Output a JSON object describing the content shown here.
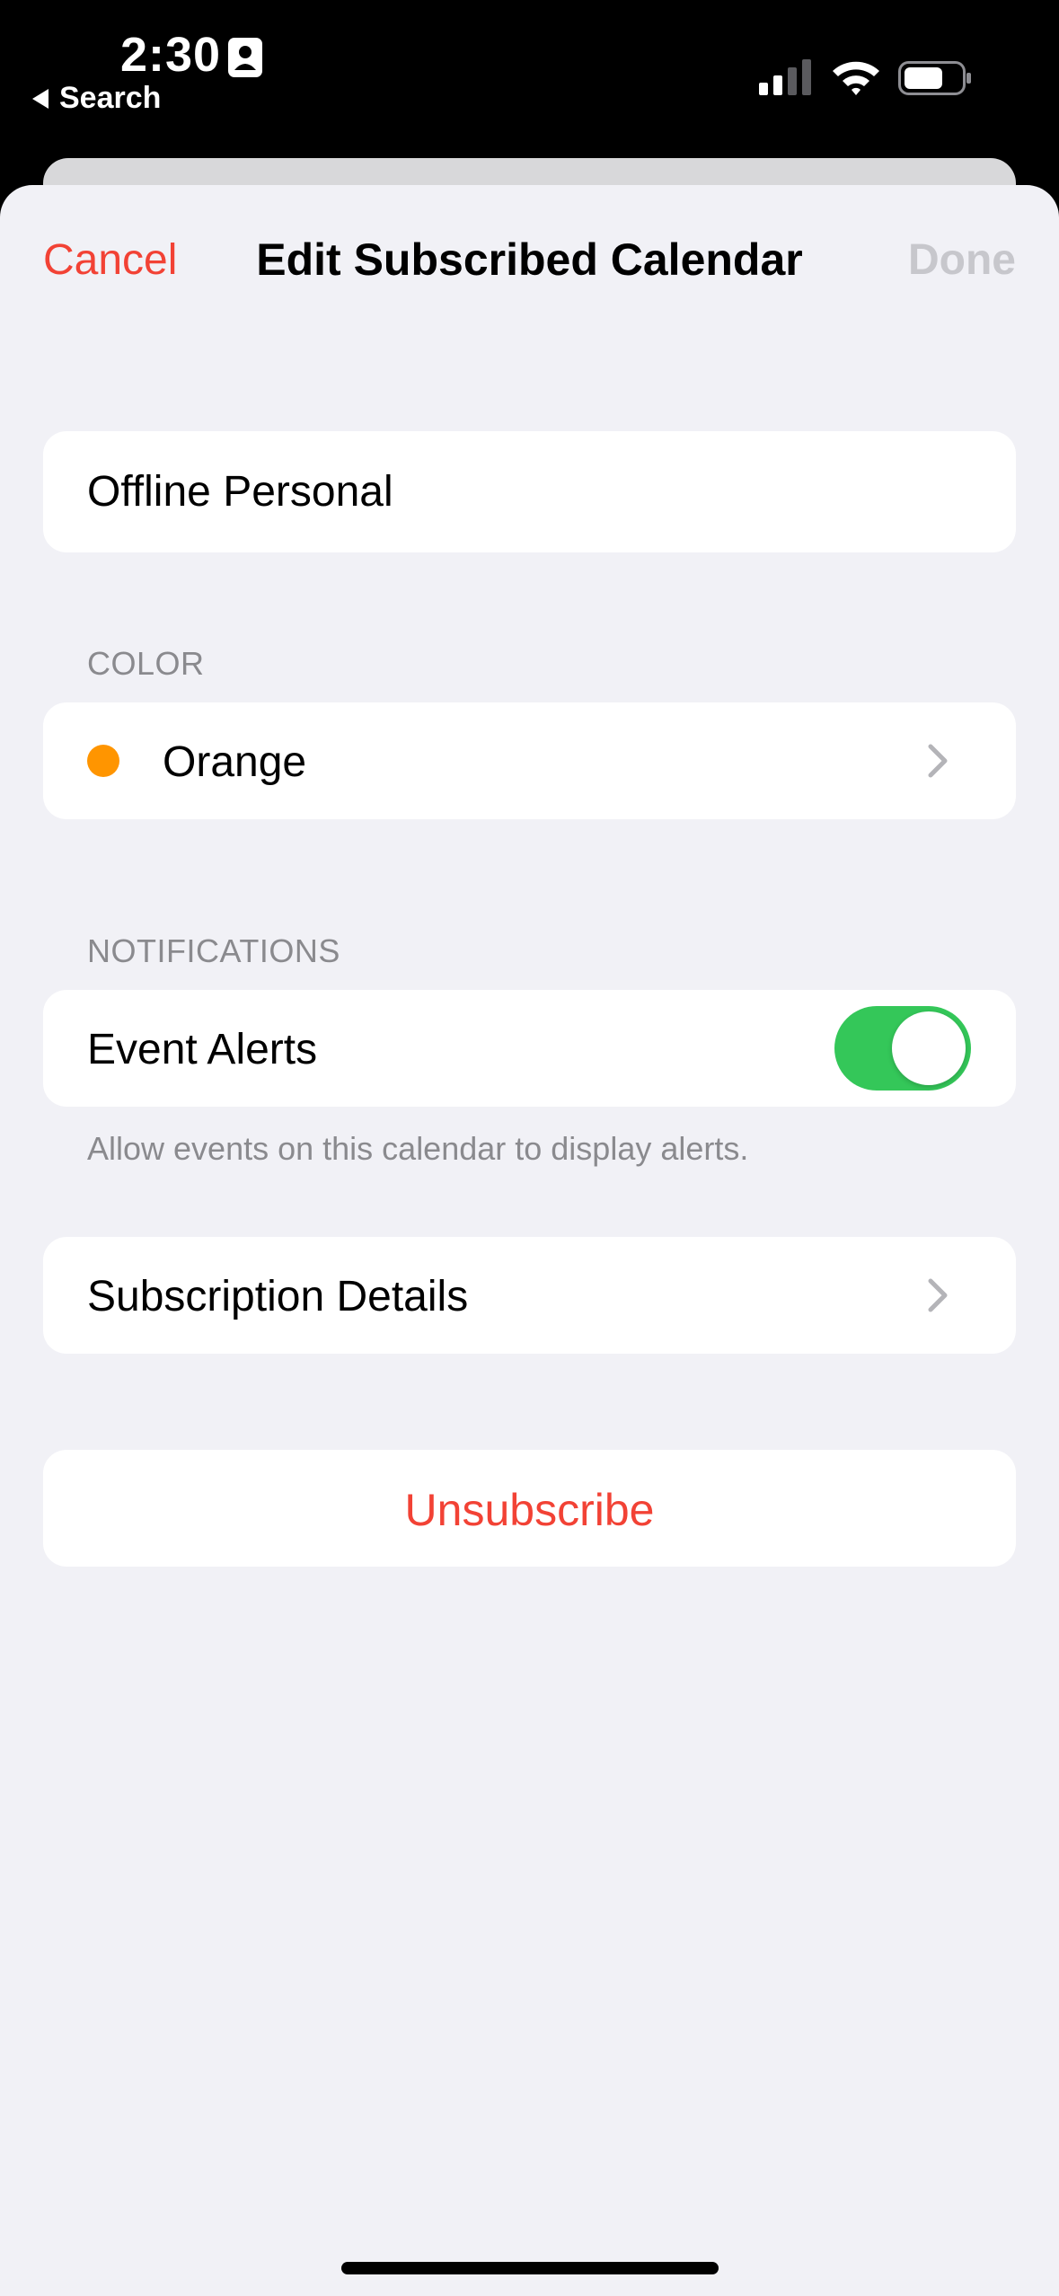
{
  "status_bar": {
    "time": "2:30",
    "back_label": "Search",
    "icons": [
      "contact-card-icon",
      "cellular-signal-icon",
      "wifi-icon",
      "battery-icon"
    ]
  },
  "nav": {
    "cancel_label": "Cancel",
    "title": "Edit Subscribed Calendar",
    "done_label": "Done"
  },
  "calendar_name": {
    "value": "Offline Personal"
  },
  "color_section": {
    "header": "COLOR",
    "selected_color_name": "Orange",
    "selected_color_hex": "#ff9500"
  },
  "notifications_section": {
    "header": "NOTIFICATIONS",
    "event_alerts_label": "Event Alerts",
    "event_alerts_on": true,
    "footer": "Allow events on this calendar to display alerts."
  },
  "subscription": {
    "details_label": "Subscription Details"
  },
  "actions": {
    "unsubscribe_label": "Unsubscribe"
  },
  "colors": {
    "accent_red": "#f24235",
    "toggle_green": "#34c759",
    "background": "#f1f1f6",
    "secondary_text": "#8a8a8e"
  }
}
